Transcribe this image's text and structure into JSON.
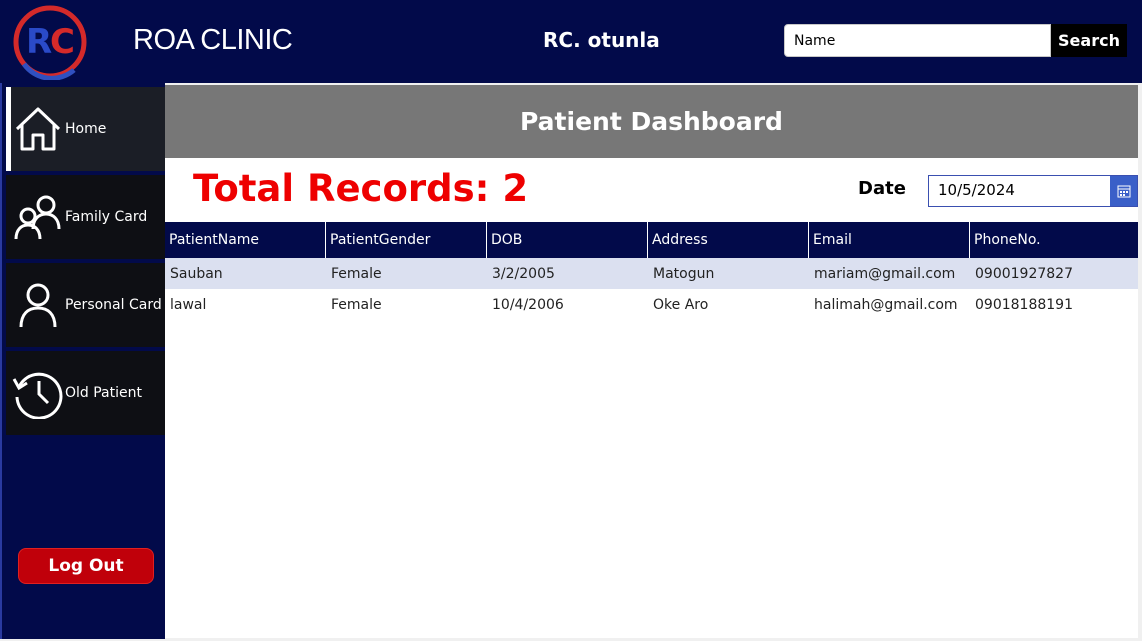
{
  "header": {
    "app_title": "ROA CLINIC",
    "user_name": "RC. otunla",
    "search_placeholder": "Name",
    "search_label": "Search",
    "logo_text": "RC"
  },
  "sidebar": {
    "items": [
      {
        "label": "Home",
        "icon": "home-icon",
        "active": true
      },
      {
        "label": "Family Card",
        "icon": "family-icon",
        "active": false
      },
      {
        "label": "Personal Card",
        "icon": "person-icon",
        "active": false
      },
      {
        "label": "Old Patient",
        "icon": "history-icon",
        "active": false
      }
    ],
    "logout_label": "Log Out"
  },
  "main": {
    "title": "Patient Dashboard",
    "total_records": "Total Records: 2",
    "date_label": "Date",
    "date_value": "10/5/2024"
  },
  "table": {
    "columns": [
      "PatientName",
      "PatientGender",
      "DOB",
      "Address",
      "Email",
      "PhoneNo."
    ],
    "rows": [
      [
        "Sauban",
        "Female",
        "3/2/2005",
        "Matogun",
        "mariam@gmail.com",
        "09001927827"
      ],
      [
        "lawal",
        "Female",
        "10/4/2006",
        "Oke Aro",
        "halimah@gmail.com",
        "09018188191"
      ]
    ]
  },
  "colors": {
    "navy": "#020a4a",
    "accent_red": "#ee0000",
    "logout_red": "#c0000a",
    "header_gray": "#777777",
    "selected_row": "#dbe0f0"
  }
}
